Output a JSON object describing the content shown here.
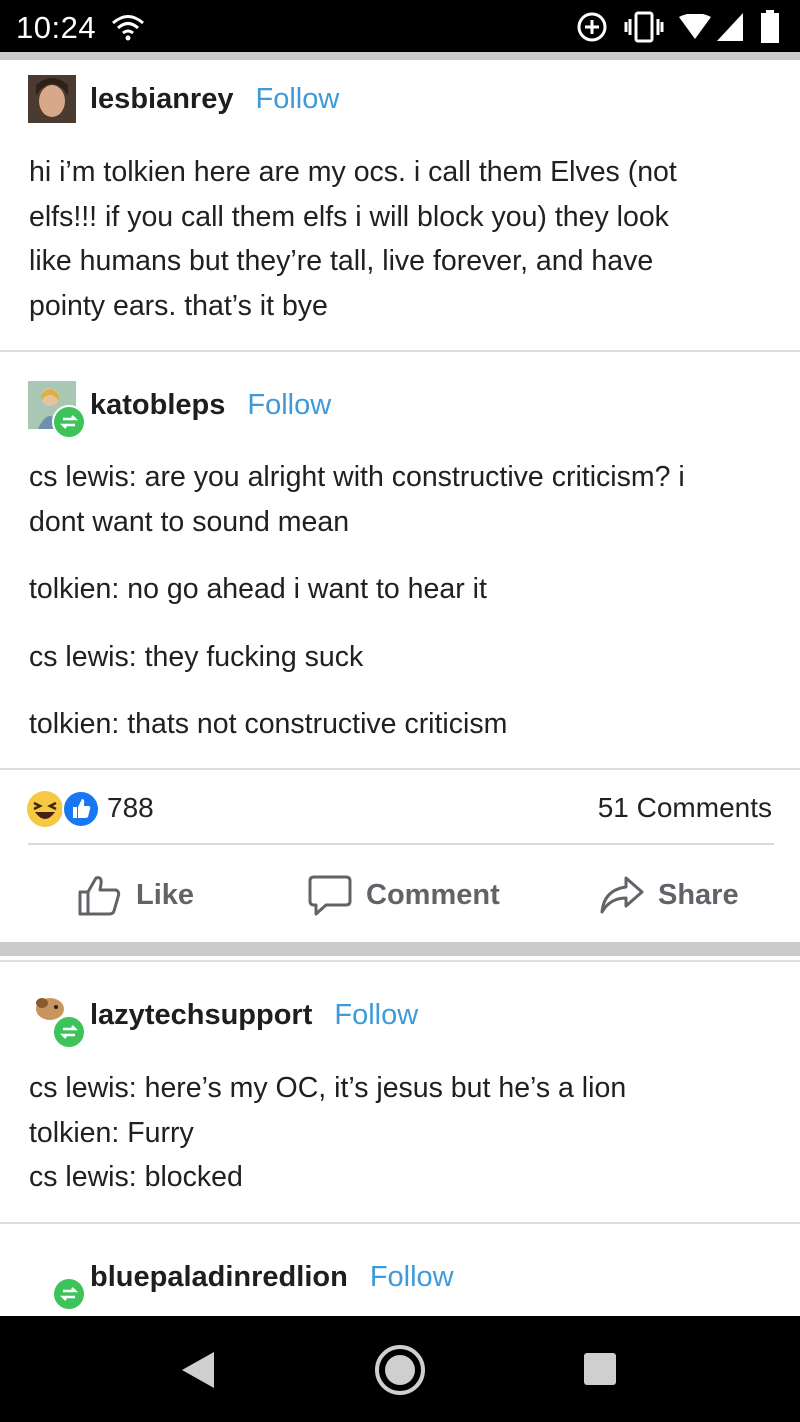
{
  "status_bar": {
    "time": "10:24"
  },
  "posts": [
    {
      "username": "lesbianrey",
      "follow": "Follow",
      "lines": [
        "hi i’m tolkien here are my ocs. i call them Elves (not",
        "elfs!!! if you call them elfs i will block you) they look",
        "like humans but they’re tall, live forever, and have",
        "pointy ears. that’s it bye"
      ]
    },
    {
      "username": "katobleps",
      "follow": "Follow",
      "lines": [
        "cs lewis: are you alright with constructive criticism? i",
        "dont want to sound mean",
        "tolkien: no go ahead i want to hear it",
        "cs lewis: they fucking suck",
        "tolkien: thats not constructive criticism"
      ]
    },
    {
      "username": "lazytechsupport",
      "follow": "Follow",
      "lines": [
        "cs lewis: here’s my OC, it’s jesus but he’s a lion",
        "tolkien: Furry",
        "cs lewis: blocked"
      ]
    },
    {
      "username": "bluepaladinredlion",
      "follow": "Follow"
    }
  ],
  "reactions": {
    "count": "788",
    "comments": "51 Comments"
  },
  "actions": {
    "like": "Like",
    "comment": "Comment",
    "share": "Share"
  },
  "colors": {
    "follow": "#3e9ad8",
    "reblog_badge": "#3ec35a",
    "like_blue": "#1877f2"
  }
}
